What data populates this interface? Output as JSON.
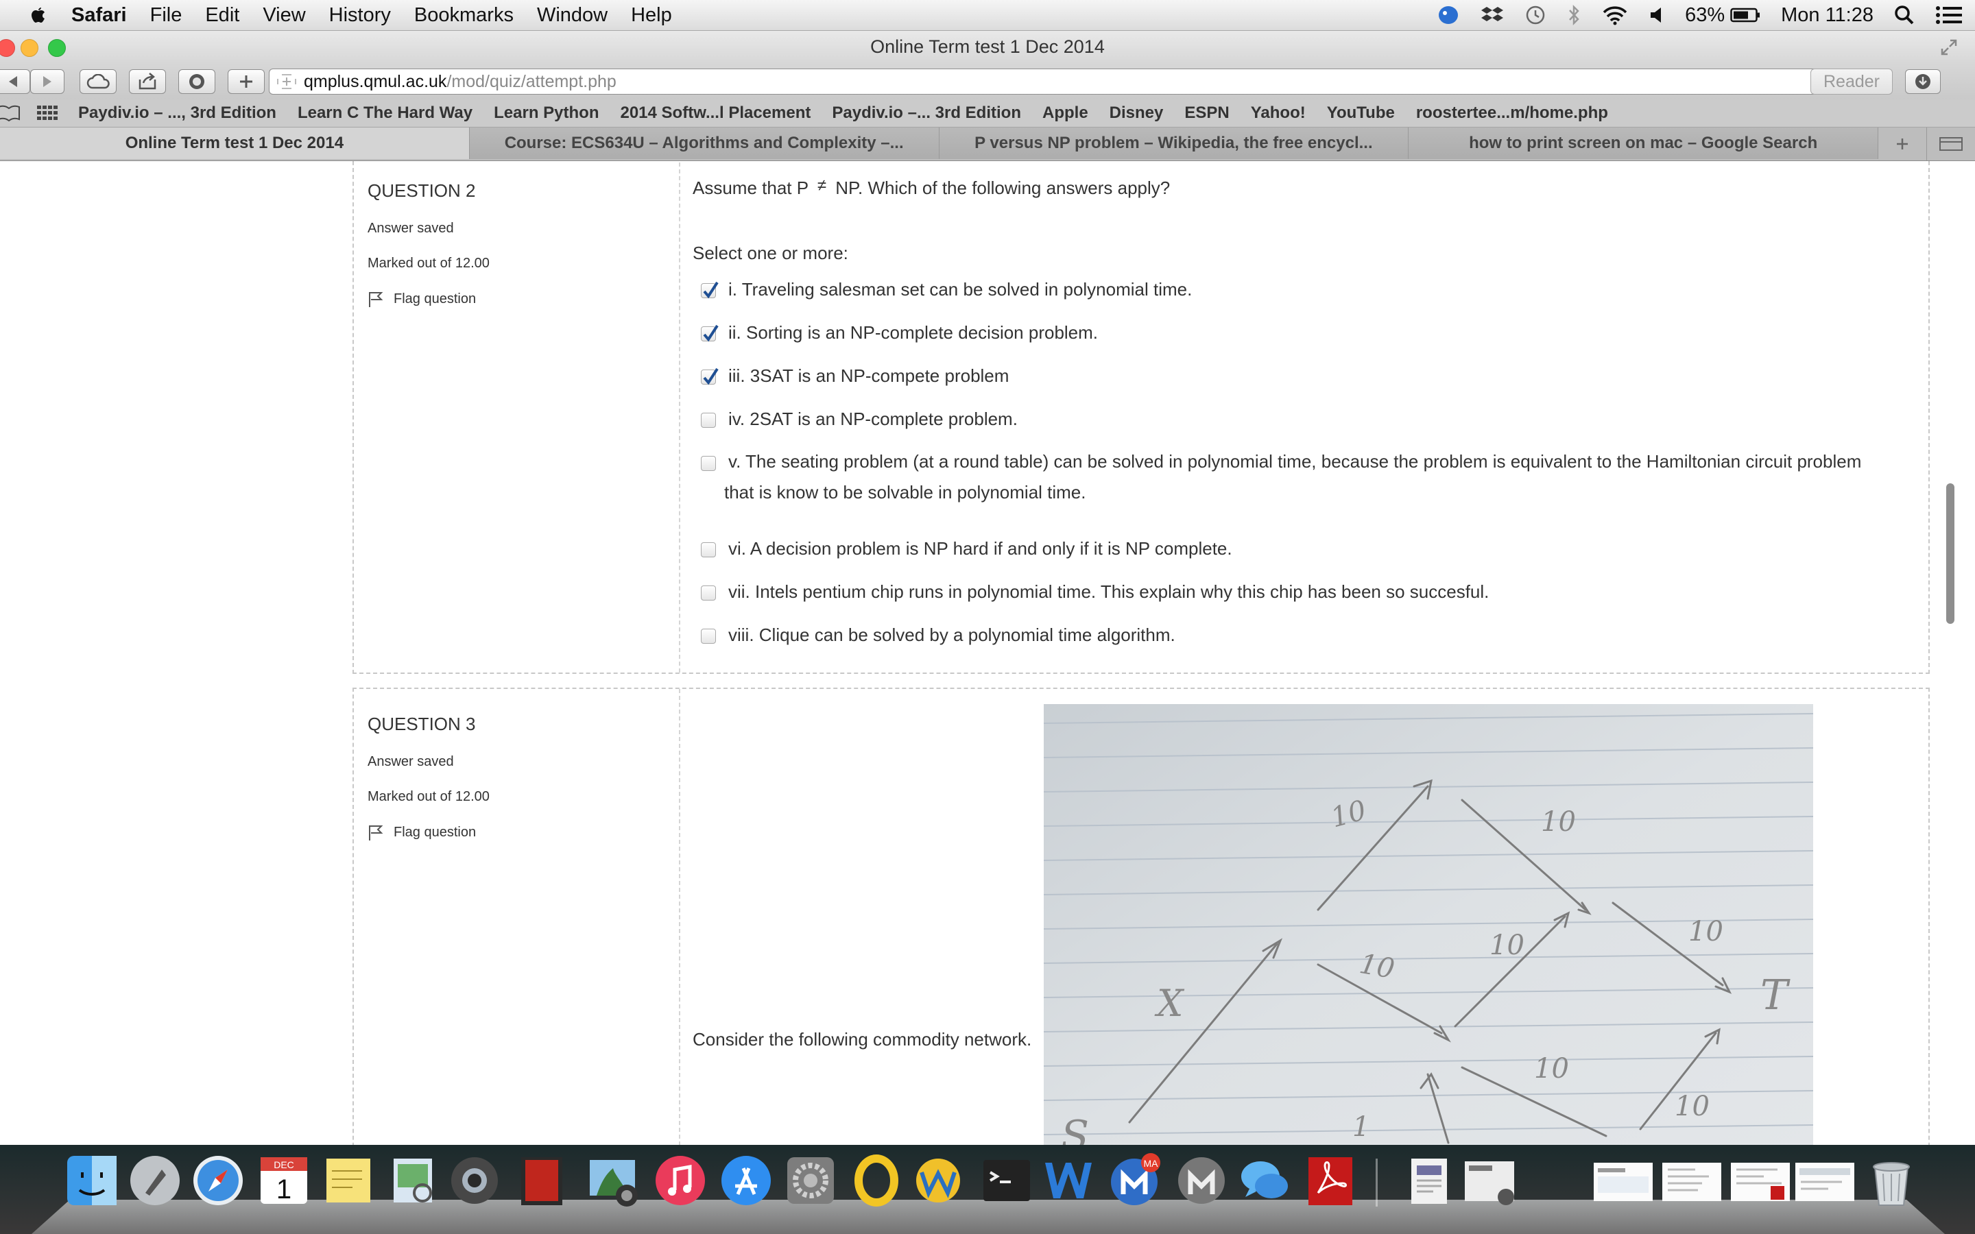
{
  "menubar": {
    "app": "Safari",
    "items": [
      "File",
      "Edit",
      "View",
      "History",
      "Bookmarks",
      "Window",
      "Help"
    ],
    "battery": "63%",
    "clock": "Mon 11:28"
  },
  "window": {
    "title": "Online Term test 1 Dec 2014"
  },
  "toolbar": {
    "url_host": "qmplus.qmul.ac.uk",
    "url_path": "/mod/quiz/attempt.php",
    "reader": "Reader"
  },
  "bookmarks": [
    "Paydiv.io – ..., 3rd Edition",
    "Learn C The Hard Way",
    "Learn Python",
    "2014 Softw...l Placement",
    "Paydiv.io –... 3rd Edition",
    "Apple",
    "Disney",
    "ESPN",
    "Yahoo!",
    "YouTube",
    "roostertee...m/home.php"
  ],
  "tabs": [
    "Online Term test 1 Dec 2014",
    "Course: ECS634U – Algorithms and Complexity –...",
    "P versus NP problem – Wikipedia, the free encycl...",
    "how to print screen on mac – Google Search"
  ],
  "question2": {
    "number": "QUESTION 2",
    "state": "Answer saved",
    "marks": "Marked out of 12.00",
    "flag": "Flag question",
    "prompt_a": "Assume that P",
    "prompt_neq": "≠",
    "prompt_b": "NP. Which of the following answers apply?",
    "select_label": "Select one or more:",
    "options": [
      {
        "text": "i. Traveling salesman set can be solved in polynomial time.",
        "checked": true
      },
      {
        "text": "ii. Sorting is an NP-complete decision problem.",
        "checked": true
      },
      {
        "text": "iii. 3SAT is an NP-compete problem",
        "checked": true
      },
      {
        "text": "iv. 2SAT is an NP-complete problem.",
        "checked": false
      },
      {
        "text": "v. The seating problem (at a round table) can be solved in polynomial time, because the problem is equivalent to the Hamiltonian circuit problem",
        "text2": "that is know to be solvable in polynomial time.",
        "checked": false
      },
      {
        "text": "vi. A decision problem is NP hard if and only if it is NP complete.",
        "checked": false
      },
      {
        "text": "vii. Intels pentium chip runs in polynomial time. This explain why this chip has been so succesful.",
        "checked": false
      },
      {
        "text": "viii. Clique can be solved by a polynomial time algorithm.",
        "checked": false
      }
    ]
  },
  "question3": {
    "number": "QUESTION 3",
    "state": "Answer saved",
    "marks": "Marked out of 12.00",
    "flag": "Flag question",
    "prompt": "Consider the following commodity network.",
    "image_labels": [
      "10",
      "10",
      "10",
      "10",
      "10",
      "10",
      "10",
      "1",
      "X",
      "T",
      "S"
    ]
  },
  "dock": {
    "calendar_month": "DEC",
    "calendar_day": "1",
    "mail_badge": "MA"
  }
}
